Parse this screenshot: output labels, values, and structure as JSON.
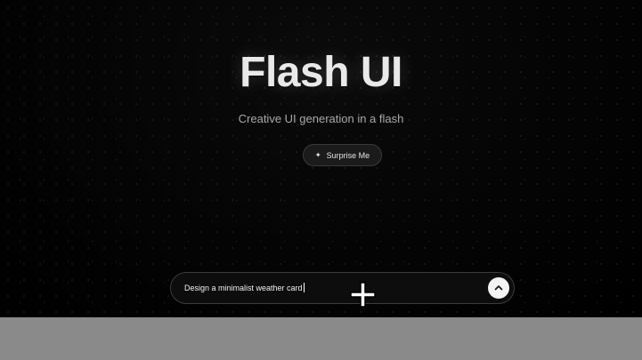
{
  "hero": {
    "title": "Flash UI",
    "subtitle": "Creative UI generation in a flash"
  },
  "surprise_button": {
    "label": "Surprise Me",
    "icon": "sparkle-icon"
  },
  "prompt": {
    "value": "Design a minimalist weather card",
    "send_icon": "chevron-up-icon"
  },
  "colors": {
    "background": "#000000",
    "title": "#e9e9e9",
    "subtitle": "#a9a9a9",
    "button_bg": "#1b1b1b",
    "send_bg": "#f4f4f4",
    "footer_bar": "#8a8a8a"
  }
}
